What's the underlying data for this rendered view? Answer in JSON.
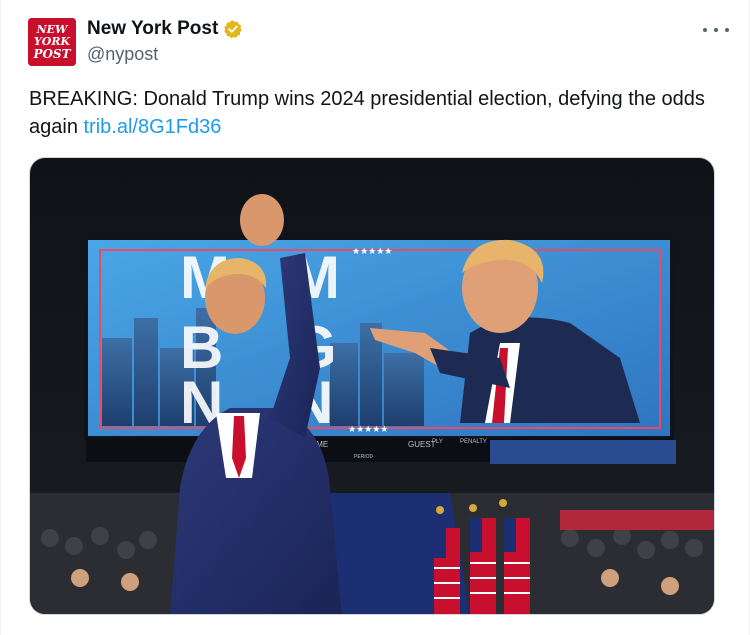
{
  "account": {
    "display_name": "New York Post",
    "handle": "@nypost",
    "avatar_logo": "NEW YORK POST",
    "verified_badge": "gold-verified-badge-icon",
    "brand_color": "#c8102e"
  },
  "more_menu": "more-options-icon",
  "tweet": {
    "text": "BREAKING: Donald Trump wins 2024 presidential election, defying the odds again ",
    "link": "trib.al/8G1Fd36",
    "link_color": "#1d9bf0"
  },
  "media": {
    "screen_labels": {
      "home": "OME",
      "guest": "GUEST",
      "ply": "PLY",
      "penalty": "PENALTY",
      "period": "PERIOD"
    },
    "stars": "★★★★★"
  }
}
